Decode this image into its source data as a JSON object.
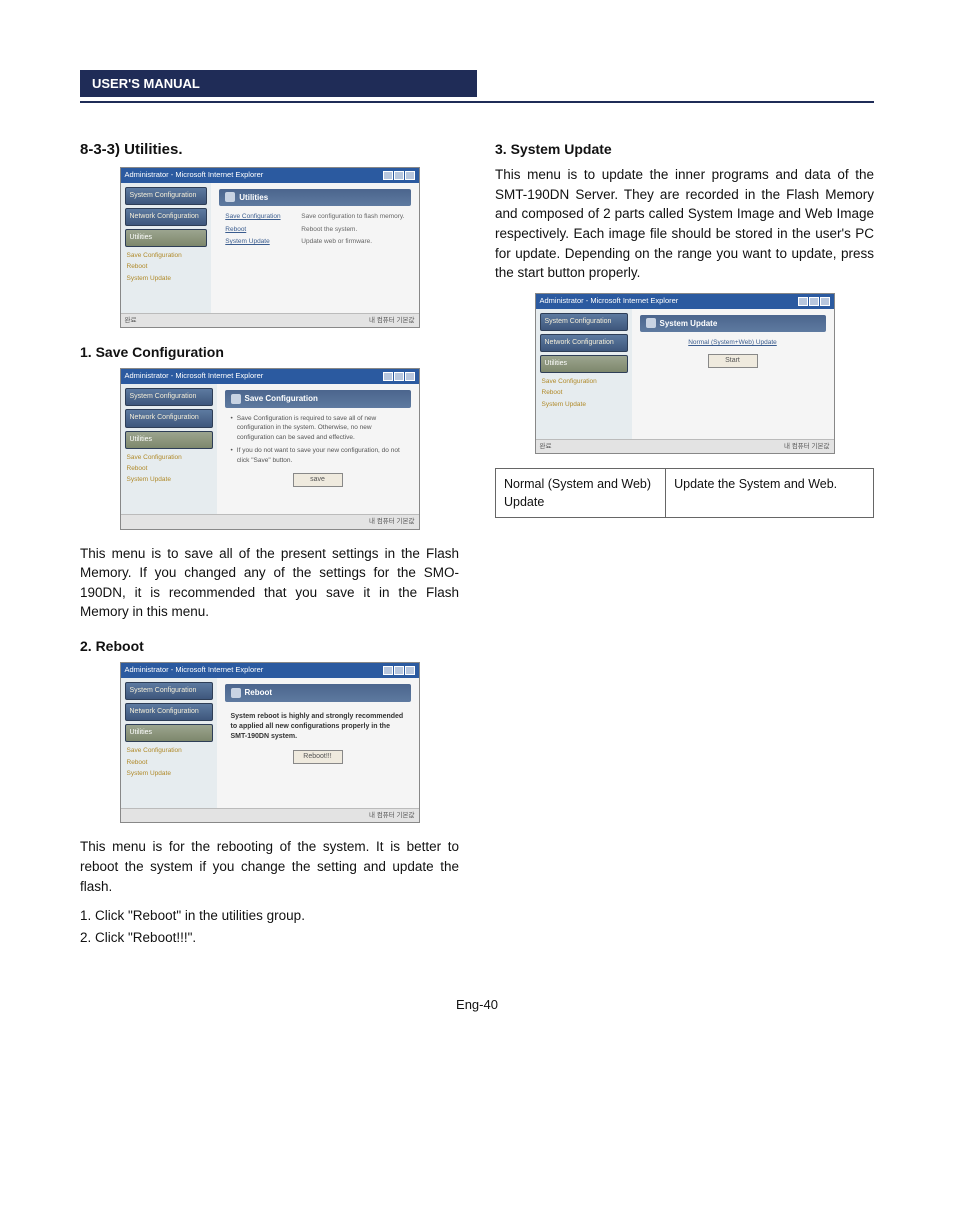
{
  "header": {
    "title": "USER'S MANUAL"
  },
  "footer": {
    "page": "Eng-40"
  },
  "left": {
    "utilities_heading": "8-3-3) Utilities.",
    "save_heading": "1. Save Configuration",
    "save_body": "This menu is to save all of the present settings in the Flash Memory. If you changed any of the settings for the SMO-190DN, it is recommended that you save it in the Flash Memory in this menu.",
    "reboot_heading": "2. Reboot",
    "reboot_body": "This menu is for the rebooting of the system. It is better to reboot the system if you change the setting and update the flash.",
    "reboot_steps": [
      "1. Click \"Reboot\" in the utilities group.",
      "2. Click \"Reboot!!!\"."
    ]
  },
  "right": {
    "update_heading": "3. System Update",
    "update_body": "This menu is to update the inner programs and data of the SMT-190DN Server. They are recorded in the Flash Memory and composed of 2 parts called System Image and Web Image respectively. Each image file should be stored in the user's PC for update. Depending on the range you want to update, press the start button properly.",
    "update_table": {
      "left": "Normal (System and Web) Update",
      "right": "Update the System and Web."
    }
  },
  "shot_common": {
    "window_title": "Administrator - Microsoft Internet Explorer",
    "side_tabs": [
      "System Configuration",
      "Network Configuration",
      "Utilities"
    ],
    "side_sub": [
      "Save Configuration",
      "Reboot",
      "System Update"
    ],
    "status_left": "완료",
    "status_right": "내 컴퓨터 기본값"
  },
  "shot_utilities": {
    "panel_title": "Utilities",
    "rows": [
      {
        "k": "Save Configuration",
        "v": "Save configuration to flash memory."
      },
      {
        "k": "Reboot",
        "v": "Reboot the system."
      },
      {
        "k": "System Update",
        "v": "Update web or firmware."
      }
    ]
  },
  "shot_save": {
    "panel_title": "Save Configuration",
    "bullets": [
      "Save Configuration is required to save all of new configuration in the system. Otherwise, no new configuration can be saved and effective.",
      "If you do not want to save your new configuration, do not click \"Save\" button."
    ],
    "button": "save"
  },
  "shot_reboot": {
    "panel_title": "Reboot",
    "note": "System reboot is highly and strongly recommended to applied all new configurations properly in the SMT-190DN system.",
    "button": "Reboot!!!"
  },
  "shot_update": {
    "panel_title": "System Update",
    "note": "Normal (System+Web) Update",
    "button": "Start"
  }
}
